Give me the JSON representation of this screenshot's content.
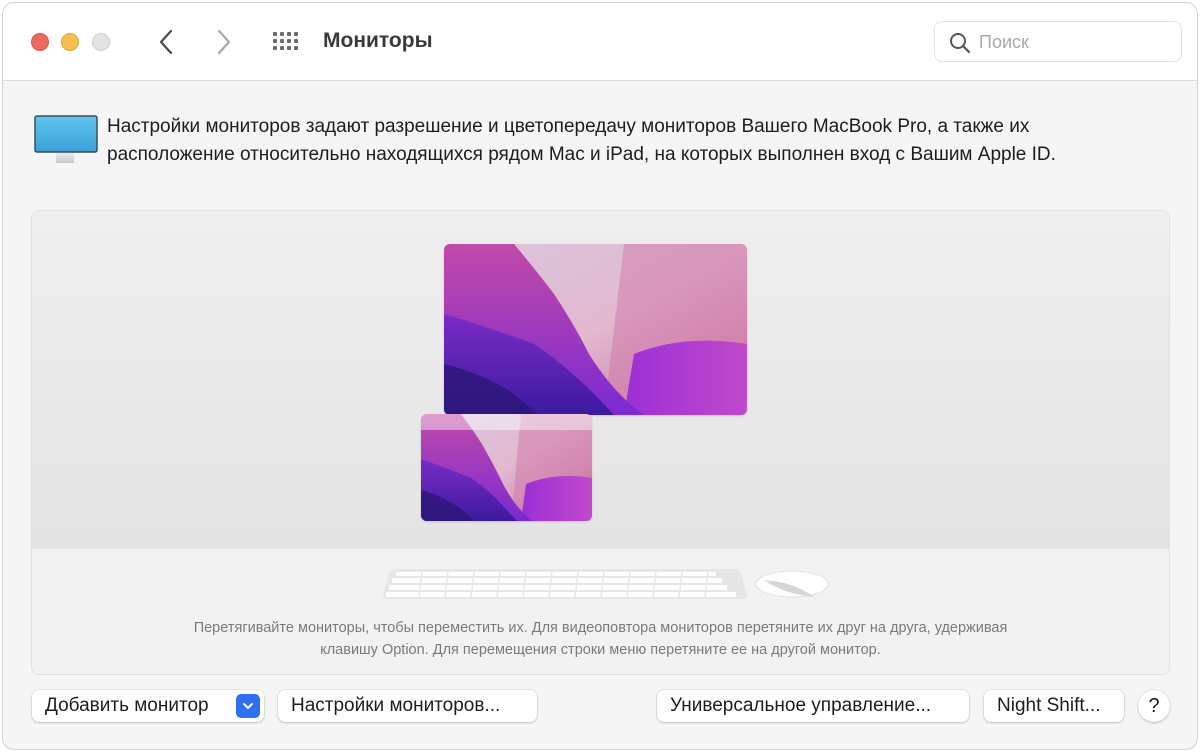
{
  "window": {
    "title": "Мониторы",
    "traffic_lights": [
      "close",
      "minimize",
      "zoom-disabled"
    ],
    "nav": {
      "back_icon": "chevron-left-icon",
      "forward_icon": "chevron-right-icon",
      "grid_icon": "show-all-grid-icon"
    },
    "search": {
      "placeholder": "Поиск",
      "value": ""
    }
  },
  "info": {
    "icon": "display-icon",
    "text": "Настройки мониторов задают разрешение и цветопередачу мониторов Вашего MacBook Pro, а также их расположение относительно находящихся рядом Mac и iPad, на которых выполнен вход с Вашим Apple ID."
  },
  "arrangement": {
    "displays": [
      {
        "name": "Main display",
        "has_menu_bar": false
      },
      {
        "name": "Secondary display",
        "has_menu_bar": true
      }
    ],
    "hint_line1": "Перетягивайте мониторы, чтобы переместить их. Для видеоповтора мониторов перетяните их друг на друга, удерживая",
    "hint_line2": "клавишу Option. Для перемещения строки меню перетяните ее на другой монитор."
  },
  "buttons": {
    "add_monitor": "Добавить монитор",
    "display_settings": "Настройки мониторов...",
    "universal_control": "Универсальное управление...",
    "night_shift": "Night Shift...",
    "help": "?"
  },
  "colors": {
    "accent": "#2f6ff3",
    "close": "#ed6a5e",
    "minimize": "#f5bf4f"
  }
}
